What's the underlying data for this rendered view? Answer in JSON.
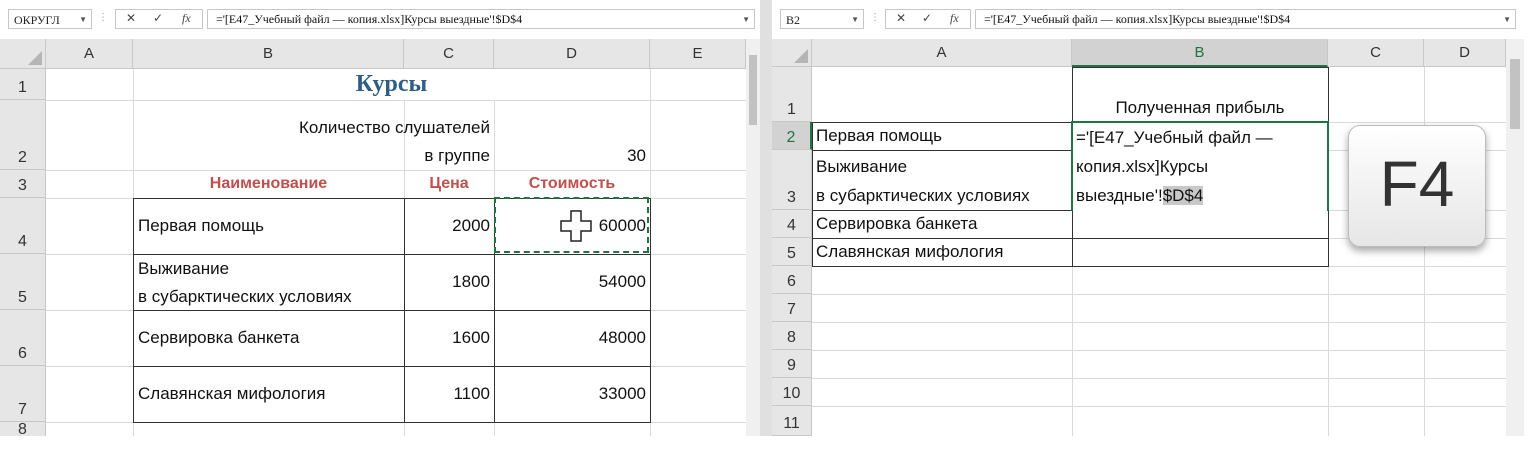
{
  "left": {
    "namebox": "ОКРУГЛ",
    "formula": "='[E47_Учебный файл — копия.xlsx]Курсы выездные'!$D$4",
    "columns": [
      "A",
      "B",
      "C",
      "D",
      "E"
    ],
    "rows": [
      "1",
      "2",
      "3",
      "4",
      "5",
      "6",
      "7",
      "8"
    ],
    "title": "Курсы",
    "listeners_label_1": "Количество слушателей",
    "listeners_label_2": "в группе",
    "listeners_value": "30",
    "headers": {
      "name": "Наименование",
      "price": "Цена",
      "cost": "Стоимость"
    },
    "items": [
      {
        "name": "Первая помощь",
        "name2": "",
        "price": "2000",
        "cost": "60000"
      },
      {
        "name": "Выживание",
        "name2": "в субарктических условиях",
        "price": "1800",
        "cost": "54000"
      },
      {
        "name": "Сервировка банкета",
        "name2": "",
        "price": "1600",
        "cost": "48000"
      },
      {
        "name": "Славянская мифология",
        "name2": "",
        "price": "1100",
        "cost": "33000"
      }
    ]
  },
  "right": {
    "namebox": "B2",
    "formula": "='[E47_Учебный файл — копия.xlsx]Курсы выездные'!$D$4",
    "columns": [
      "A",
      "B",
      "C",
      "D"
    ],
    "rows": [
      "1",
      "2",
      "3",
      "4",
      "5",
      "6",
      "7",
      "8",
      "9",
      "10",
      "11"
    ],
    "b1": "Полученная прибыль",
    "items": [
      "Первая помощь",
      "Выживание",
      "в субарктических условиях",
      "Сервировка банкета",
      "Славянская мифология"
    ],
    "edit_line1": "='[E47_Учебный файл —",
    "edit_line2": "копия.xlsx]Курсы",
    "edit_line3": "выездные'!",
    "edit_ref": "$D$4"
  },
  "key_label": "F4",
  "fx_symbol": "fx"
}
